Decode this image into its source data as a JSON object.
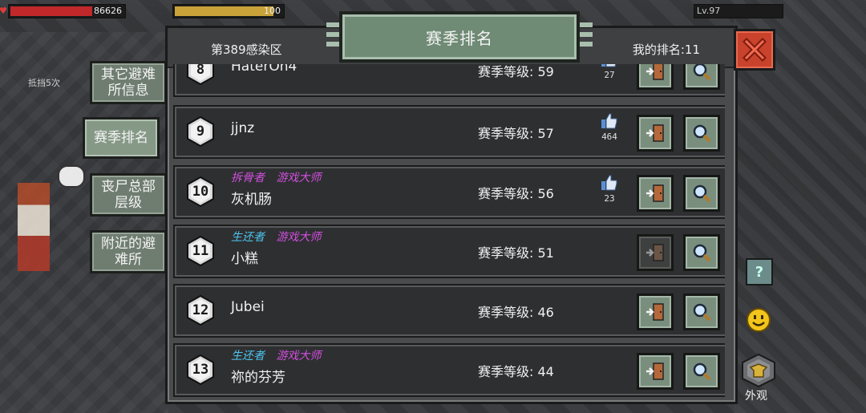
{
  "hud": {
    "hp_value": "86626",
    "hp_fraction": 0.72,
    "food_value": "100",
    "food_fraction": 0.92,
    "level": "Lv.97",
    "bg_text": "抵挡5次"
  },
  "side_menu": {
    "items": [
      {
        "label": "其它避难所信息",
        "active": false
      },
      {
        "label": "赛季排名",
        "active": true
      },
      {
        "label": "丧尸总部层级",
        "active": false
      },
      {
        "label": "附近的避难所",
        "active": false
      }
    ]
  },
  "panel": {
    "title": "赛季排名",
    "zone": "第389感染区",
    "my_rank": "我的排名:11"
  },
  "rankings": [
    {
      "rank": "8",
      "name": "HaterOn4",
      "titles": [],
      "level_text": "赛季等级: 59",
      "likes": "27",
      "visit_enabled": true
    },
    {
      "rank": "9",
      "name": "jjnz",
      "titles": [],
      "level_text": "赛季等级: 57",
      "likes": "464",
      "visit_enabled": true
    },
    {
      "rank": "10",
      "name": "灰机肠",
      "titles": [
        "拆骨者",
        "游戏大师"
      ],
      "level_text": "赛季等级: 56",
      "likes": "23",
      "visit_enabled": true
    },
    {
      "rank": "11",
      "name": "小糕",
      "titles": [
        "生还者",
        "游戏大师"
      ],
      "level_text": "赛季等级: 51",
      "likes": "",
      "visit_enabled": false
    },
    {
      "rank": "12",
      "name": "Jubei",
      "titles": [],
      "level_text": "赛季等级: 46",
      "likes": "",
      "visit_enabled": true
    },
    {
      "rank": "13",
      "name": "祢的芬芳",
      "titles": [
        "生还者",
        "游戏大师"
      ],
      "level_text": "赛季等级: 44",
      "likes": "",
      "visit_enabled": true
    }
  ],
  "right_bar": {
    "help": "?",
    "appearance_label": "外观"
  },
  "colors": {
    "title_purple": "#d34fe0",
    "title_blue": "#4cc6f0",
    "close_red": "#c9422c",
    "button_green": "#7a8e7e"
  }
}
